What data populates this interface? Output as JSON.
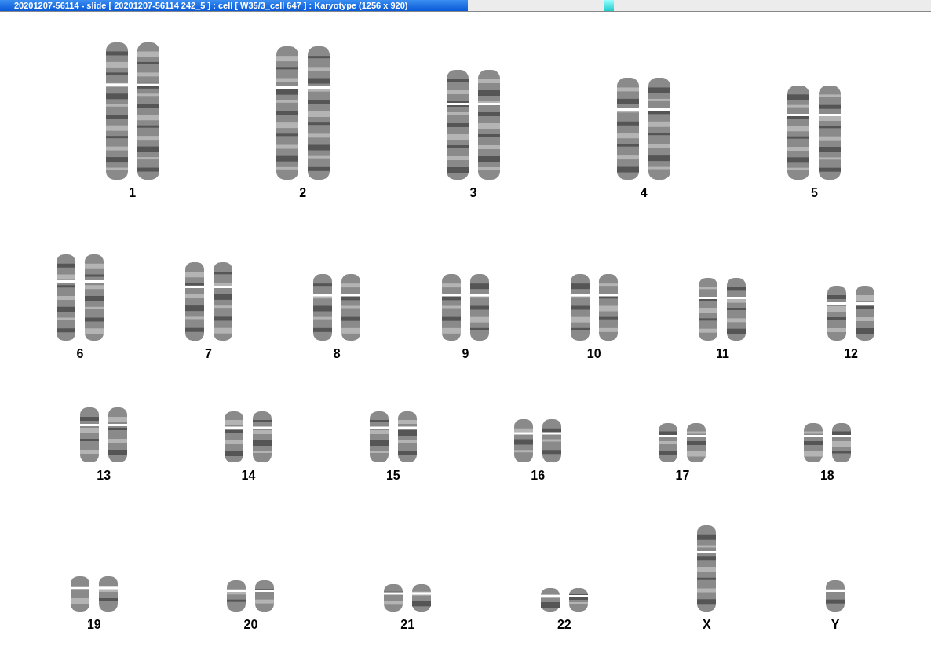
{
  "window": {
    "title": "20201207-56114 - slide [ 20201207-56114 242_5 ] : cell [ W35/3_cell 647 ] : Karyotype  (1256 x 920)"
  },
  "karyotype": {
    "rows": [
      {
        "chromosomes": [
          {
            "label": "1",
            "kind": "pair"
          },
          {
            "label": "2",
            "kind": "pair"
          },
          {
            "label": "3",
            "kind": "pair"
          },
          {
            "label": "4",
            "kind": "pair"
          },
          {
            "label": "5",
            "kind": "pair"
          }
        ]
      },
      {
        "chromosomes": [
          {
            "label": "6",
            "kind": "pair"
          },
          {
            "label": "7",
            "kind": "pair"
          },
          {
            "label": "8",
            "kind": "pair"
          },
          {
            "label": "9",
            "kind": "pair"
          },
          {
            "label": "10",
            "kind": "pair"
          },
          {
            "label": "11",
            "kind": "pair"
          },
          {
            "label": "12",
            "kind": "pair"
          }
        ]
      },
      {
        "chromosomes": [
          {
            "label": "13",
            "kind": "pair"
          },
          {
            "label": "14",
            "kind": "pair"
          },
          {
            "label": "15",
            "kind": "pair"
          },
          {
            "label": "16",
            "kind": "pair"
          },
          {
            "label": "17",
            "kind": "pair"
          },
          {
            "label": "18",
            "kind": "pair"
          }
        ]
      },
      {
        "chromosomes": [
          {
            "label": "19",
            "kind": "pair"
          },
          {
            "label": "20",
            "kind": "pair"
          },
          {
            "label": "21",
            "kind": "pair"
          },
          {
            "label": "22",
            "kind": "pair"
          },
          {
            "label": "X",
            "kind": "single"
          },
          {
            "label": "Y",
            "kind": "single"
          }
        ]
      }
    ]
  }
}
